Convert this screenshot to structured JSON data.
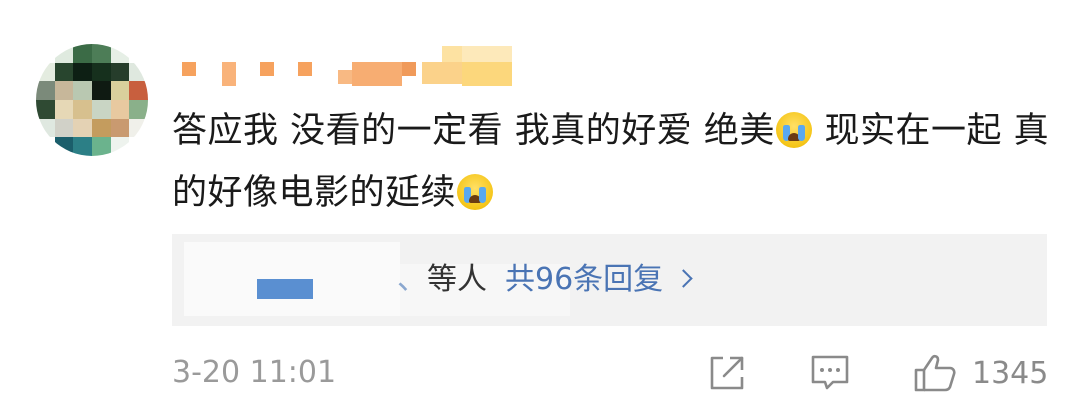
{
  "comment": {
    "username_obscured": true,
    "body_parts": [
      "答应我 没看的一定看 我真的好爱 绝美",
      " 现实在一起 真的好像电影的延续"
    ],
    "emoji_icon": "crying-face-icon",
    "replies": {
      "prefix_glyph": "、",
      "suffix": "等人",
      "count_label": "共96条回复"
    },
    "time": "3-20 11:01",
    "like_count": "1345"
  },
  "icons": {
    "share": "share-icon",
    "reply": "comment-icon",
    "like": "thumbs-up-icon",
    "chevron": "chevron-right-icon"
  },
  "colors": {
    "link_blue": "#4a74b4",
    "meta_gray": "#9a9a9a",
    "text_dark": "#1a1a1a",
    "reply_bg": "#f2f2f2"
  }
}
